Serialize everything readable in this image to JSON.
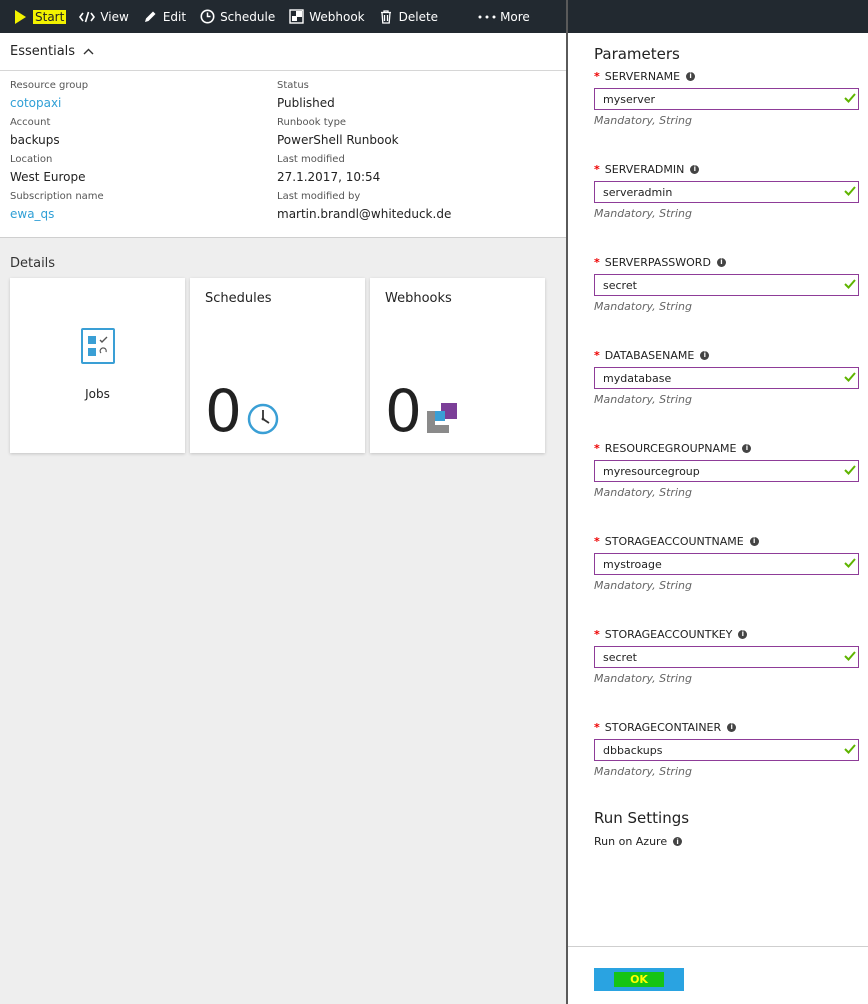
{
  "toolbar": {
    "start": "Start",
    "view": "View",
    "edit": "Edit",
    "schedule": "Schedule",
    "webhook": "Webhook",
    "delete": "Delete",
    "more": "More"
  },
  "essentials": {
    "title": "Essentials",
    "left": [
      {
        "key": "Resource group",
        "value": "cotopaxi",
        "link": true
      },
      {
        "key": "Account",
        "value": "backups",
        "link": false
      },
      {
        "key": "Location",
        "value": "West Europe",
        "link": false
      },
      {
        "key": "Subscription name",
        "value": "ewa_qs",
        "link": true
      }
    ],
    "right": [
      {
        "key": "Status",
        "value": "Published"
      },
      {
        "key": "Runbook type",
        "value": "PowerShell Runbook"
      },
      {
        "key": "Last modified",
        "value": "27.1.2017, 10:54"
      },
      {
        "key": "Last modified by",
        "value": "martin.brandl@whiteduck.de"
      }
    ]
  },
  "details": {
    "title": "Details",
    "jobs_label": "Jobs",
    "schedules_title": "Schedules",
    "schedules_count": "0",
    "webhooks_title": "Webhooks",
    "webhooks_count": "0"
  },
  "parameters": {
    "title": "Parameters",
    "hint": "Mandatory, String",
    "required_mark": "*",
    "items": [
      {
        "name": "SERVERNAME",
        "value": "myserver"
      },
      {
        "name": "SERVERADMIN",
        "value": "serveradmin"
      },
      {
        "name": "SERVERPASSWORD",
        "value": "secret"
      },
      {
        "name": "DATABASENAME",
        "value": "mydatabase"
      },
      {
        "name": "RESOURCEGROUPNAME",
        "value": "myresourcegroup"
      },
      {
        "name": "STORAGEACCOUNTNAME",
        "value": "mystroage"
      },
      {
        "name": "STORAGEACCOUNTKEY",
        "value": "secret"
      },
      {
        "name": "STORAGECONTAINER",
        "value": "dbbackups"
      }
    ]
  },
  "run_settings": {
    "title": "Run Settings",
    "option": "Run on Azure"
  },
  "footer": {
    "ok": "OK"
  },
  "colors": {
    "toolbar_bg": "#222930",
    "link": "#2f9fd6",
    "input_border": "#8e3c98",
    "check": "#5fb400",
    "ok_bg": "#2aa3e1"
  }
}
